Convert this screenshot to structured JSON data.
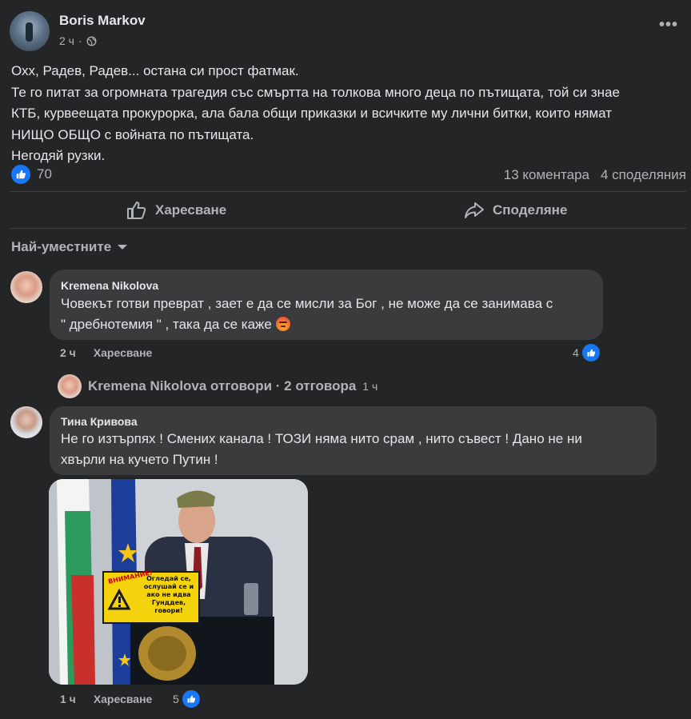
{
  "post": {
    "author": "Boris Markov",
    "time": "2 ч",
    "privacy_icon": "globe-icon",
    "lines": [
      "Охх, Радев, Радев... остана си прост фатмак.",
      "Те го питат за огромната трагедия със смъртта на толкова много деца по пътищата, той си знае",
      "КТБ, курвеещата прокурорка, ала бала общи приказки и всичките му лични битки, които нямат",
      "НИЩО ОБЩО с войната по пътищата.",
      "Негодяй рузки."
    ],
    "reaction_count": "70",
    "comments_count": "13 коментара",
    "shares_count": "4 споделяния"
  },
  "actions": {
    "like_label": "Харесване",
    "share_label": "Споделяне"
  },
  "sort": {
    "label": "Най-уместните"
  },
  "comments": [
    {
      "author": "Kremena Nikolova",
      "line1": "Човекът готви преврат , зает е да се мисли за Бог , не може да се занимава с",
      "line2": "\" дребнотемия \" , така да се каже",
      "emoji": "angry-emoji",
      "time": "2 ч",
      "like_label": "Харесване",
      "reactions": "4"
    },
    {
      "author": "Тина Кривова",
      "line1": "Не го изтърпях ! Смених канала ! ТОЗИ няма нито срам , нито съвест ! Дано не ни",
      "line2": "хвърли на кучето Путин !",
      "time": "1 ч",
      "like_label": "Харесване",
      "reactions": "5"
    }
  ],
  "reply_summary": {
    "text": "Kremena Nikolova отговори · 2 отговора",
    "time": "1 ч"
  },
  "image": {
    "sign_title": "ВНИМАНИЕ!",
    "sign_text": "Огледай се, ослушай се и ако не идва Гунддев, говори!"
  },
  "colors": {
    "background": "#242526",
    "bubble": "#3a3b3c",
    "text_primary": "#e4e6eb",
    "text_secondary": "#b0b3b8",
    "like_blue": "#1877f2"
  }
}
